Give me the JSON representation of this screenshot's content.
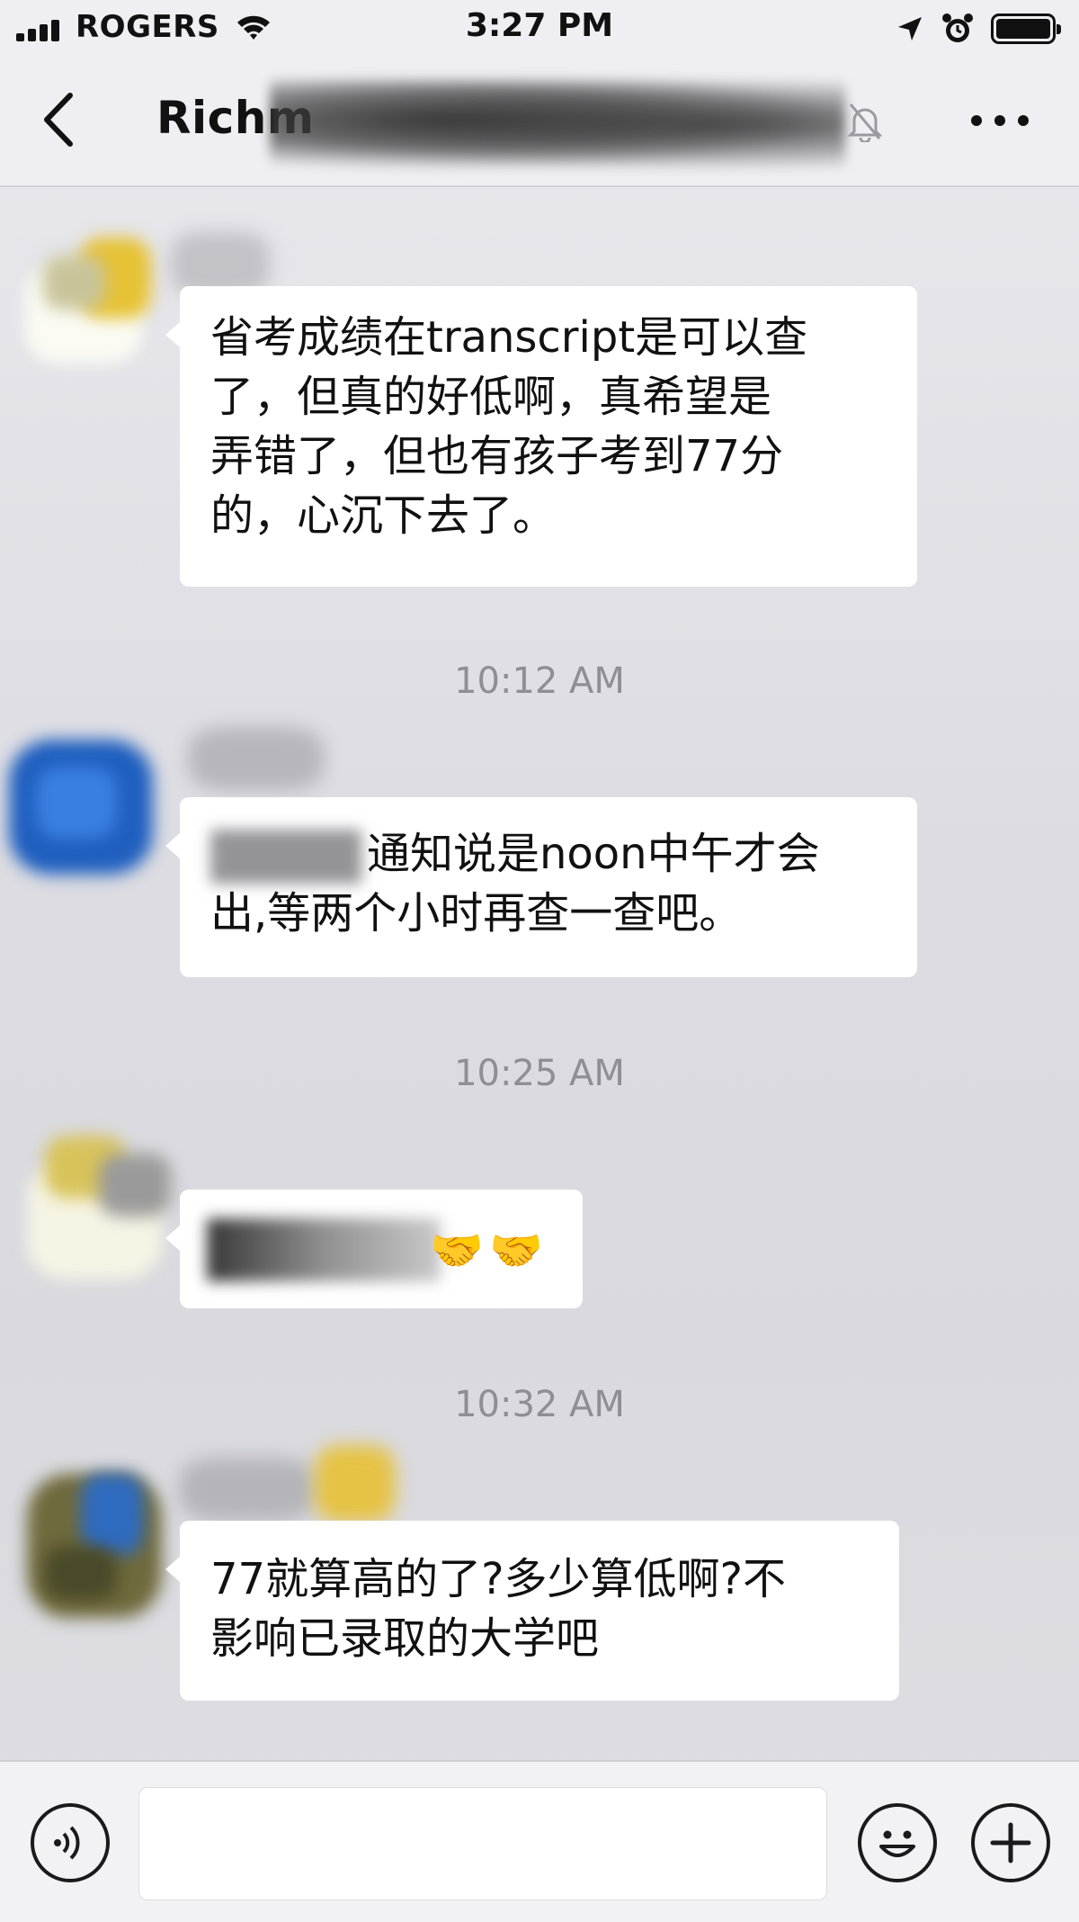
{
  "status_bar": {
    "carrier": "ROGERS",
    "time": "3:27 PM"
  },
  "nav": {
    "title": "Richm"
  },
  "messages": [
    {
      "lines": [
        "省考成绩在transcript是可以查",
        "了，但真的好低啊，真希望是",
        "弄错了，但也有孩子考到77分",
        "的，心沉下去了。"
      ]
    },
    {
      "lines": [
        "通知说是noon中午才会",
        "出,等两个小时再查一查吧。"
      ]
    },
    {
      "emoji": [
        "🤝",
        "🤝"
      ]
    },
    {
      "lines": [
        "77就算高的了?多少算低啊?不",
        "影响已录取的大学吧"
      ]
    }
  ],
  "timestamps": [
    "10:12 AM",
    "10:25 AM",
    "10:32 AM"
  ],
  "colors": {
    "background": "#e3e3e8",
    "bubble": "#ffffff",
    "timestamp": "#8e8e93",
    "emoji": "#f2a020"
  }
}
